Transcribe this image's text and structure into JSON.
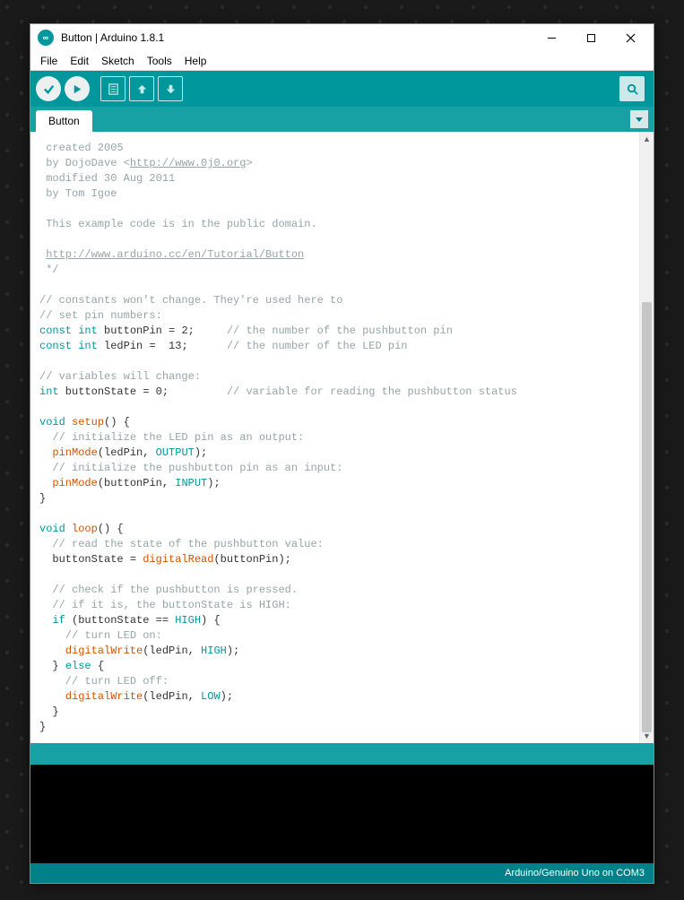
{
  "window": {
    "title": "Button | Arduino 1.8.1"
  },
  "menu": {
    "file": "File",
    "edit": "Edit",
    "sketch": "Sketch",
    "tools": "Tools",
    "help": "Help"
  },
  "tabs": {
    "current": "Button"
  },
  "footer": {
    "board": "Arduino/Genuino Uno on COM3"
  },
  "code": {
    "l1": " created 2005",
    "l2": " by DojoDave <",
    "l2link": "http://www.0j0.org",
    "l2b": ">",
    "l3": " modified 30 Aug 2011",
    "l4": " by Tom Igoe",
    "l6": " This example code is in the public domain.",
    "l8": " ",
    "l8link": "http://www.arduino.cc/en/Tutorial/Button",
    "l9": " */",
    "l11": "// constants won't change. They're used here to",
    "l12": "// set pin numbers:",
    "l13a": "const",
    "l13b": "int",
    "l13c": " buttonPin = 2;     ",
    "l13d": "// the number of the pushbutton pin",
    "l14a": "const",
    "l14b": "int",
    "l14c": " ledPin =  13;      ",
    "l14d": "// the number of the LED pin",
    "l16": "// variables will change:",
    "l17a": "int",
    "l17b": " buttonState = 0;         ",
    "l17c": "// variable for reading the pushbutton status",
    "l19a": "void",
    "l19b": "setup",
    "l19c": "() {",
    "l20": "  // initialize the LED pin as an output:",
    "l21a": "  ",
    "l21b": "pinMode",
    "l21c": "(ledPin, ",
    "l21d": "OUTPUT",
    "l21e": ");",
    "l22": "  // initialize the pushbutton pin as an input:",
    "l23a": "  ",
    "l23b": "pinMode",
    "l23c": "(buttonPin, ",
    "l23d": "INPUT",
    "l23e": ");",
    "l24": "}",
    "l26a": "void",
    "l26b": "loop",
    "l26c": "() {",
    "l27": "  // read the state of the pushbutton value:",
    "l28a": "  buttonState = ",
    "l28b": "digitalRead",
    "l28c": "(buttonPin);",
    "l30": "  // check if the pushbutton is pressed.",
    "l31": "  // if it is, the buttonState is HIGH:",
    "l32a": "  ",
    "l32b": "if",
    "l32c": " (buttonState == ",
    "l32d": "HIGH",
    "l32e": ") {",
    "l33": "    // turn LED on:",
    "l34a": "    ",
    "l34b": "digitalWrite",
    "l34c": "(ledPin, ",
    "l34d": "HIGH",
    "l34e": ");",
    "l35a": "  } ",
    "l35b": "else",
    "l35c": " {",
    "l36": "    // turn LED off:",
    "l37a": "    ",
    "l37b": "digitalWrite",
    "l37c": "(ledPin, ",
    "l37d": "LOW",
    "l37e": ");",
    "l38": "  }",
    "l39": "}"
  }
}
